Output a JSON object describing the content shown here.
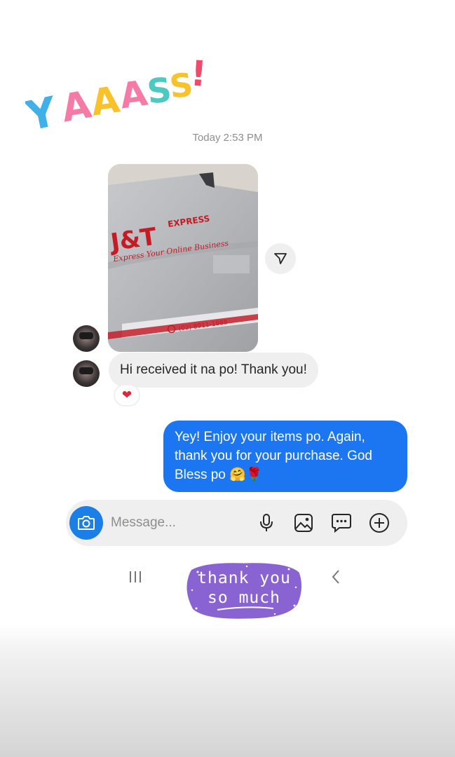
{
  "sticker_top": {
    "letters": [
      "Y",
      "A",
      "A",
      "A",
      "S",
      "S",
      "!"
    ],
    "colors": [
      "#3fb0e8",
      "#f57ba6",
      "#f8c32a",
      "#f57ba6",
      "#4dc9c1",
      "#f8c32a",
      "#ef4a6c"
    ]
  },
  "timestamp": "Today 2:53 PM",
  "photo": {
    "brand": "J&T",
    "brand_sub": "EXPRESS",
    "tagline": "Express Your Online Business",
    "hotline": "(02) 8911-1888"
  },
  "received_message": "Hi received it na po! Thank you!",
  "reaction": "❤",
  "sent_message": {
    "line1": "Yey! Enjoy your items po. Again,",
    "line2": "thank you for your purchase. God",
    "line3": "Bless po 🤗🌹"
  },
  "composer": {
    "placeholder": "Message..."
  },
  "icons": {
    "camera": "camera-icon",
    "mic": "microphone-icon",
    "gallery": "image-icon",
    "sticker": "chat-bubble-icon",
    "add": "plus-circle-icon",
    "forward": "send-icon"
  },
  "sticker_bottom": {
    "line1": "thank you",
    "line2": "so much",
    "color": "#8a63d2"
  },
  "colors": {
    "sent_bubble": "#1c76f2",
    "received_bubble": "#efefef",
    "camera_button": "#1c7fe8"
  }
}
